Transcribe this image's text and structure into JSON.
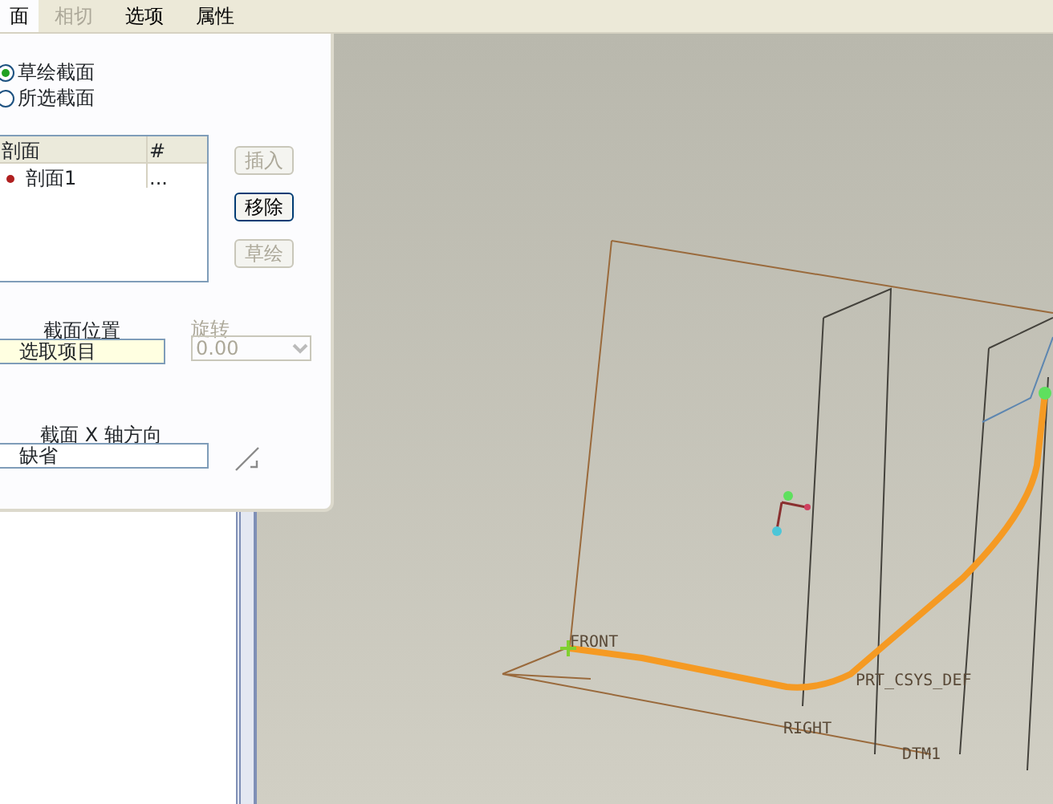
{
  "tabs": [
    {
      "label": "面",
      "selected": true,
      "disabled": false
    },
    {
      "label": "相切",
      "selected": false,
      "disabled": true
    },
    {
      "label": "选项",
      "selected": false,
      "disabled": false
    },
    {
      "label": "属性",
      "selected": false,
      "disabled": false
    }
  ],
  "section_mode": [
    {
      "label": "草绘截面",
      "selected": true
    },
    {
      "label": "所选截面",
      "selected": false
    }
  ],
  "sections_table": {
    "columns": [
      "剖面",
      "#"
    ],
    "rows": [
      {
        "cells": [
          "剖面1",
          "..."
        ]
      }
    ]
  },
  "section_buttons": [
    {
      "label": "插入",
      "disabled": true
    },
    {
      "label": "移除",
      "disabled": false
    },
    {
      "label": "草绘",
      "disabled": true
    }
  ],
  "section_location": {
    "label": "截面位置",
    "value": "选取项目"
  },
  "rotation": {
    "label": "旋转",
    "value": "0.00",
    "disabled": true
  },
  "x_axis_direction": {
    "label": "截面 X 轴方向",
    "value": "缺省"
  },
  "viewport_labels": [
    "FRONT",
    "PRT_CSYS_DEF",
    "RIGHT",
    "DTM1"
  ]
}
